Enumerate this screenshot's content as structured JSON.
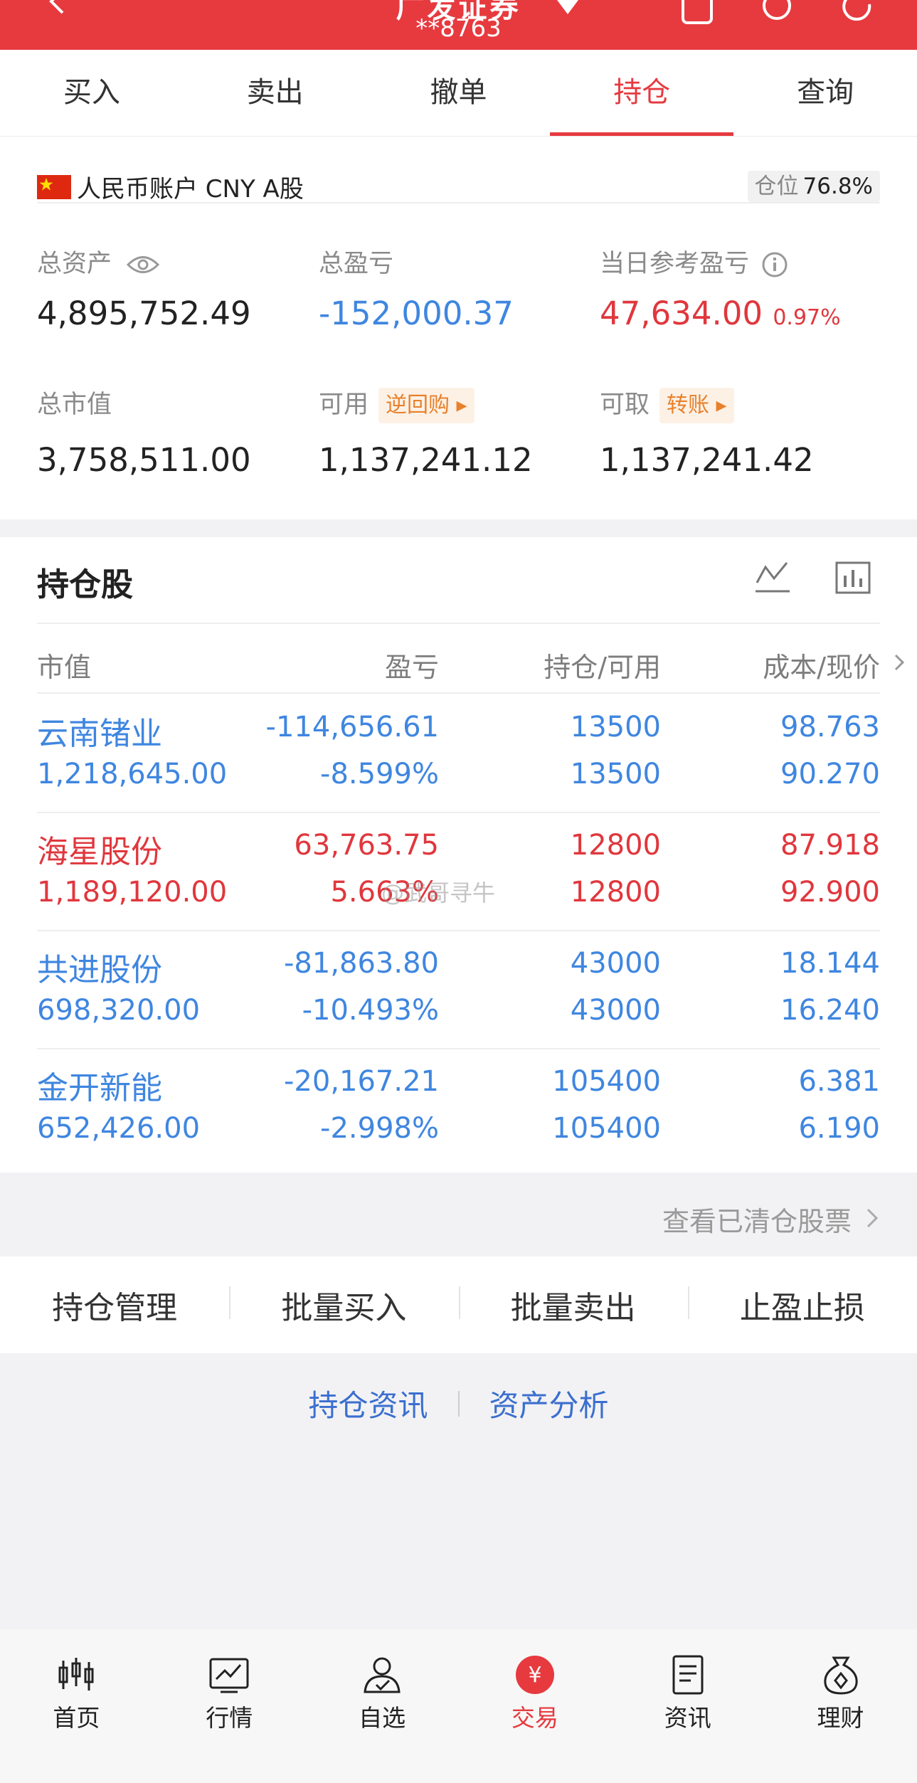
{
  "header": {
    "title": "广发证券",
    "account": "**8763"
  },
  "tabs": [
    {
      "label": "买入"
    },
    {
      "label": "卖出"
    },
    {
      "label": "撤单"
    },
    {
      "label": "持仓"
    },
    {
      "label": "查询"
    }
  ],
  "account": {
    "name": "人民币账户 CNY A股",
    "position_label": "仓位",
    "position_value": "76.8%"
  },
  "stats": {
    "total_assets_label": "总资产",
    "total_assets_value": "4,895,752.49",
    "total_pl_label": "总盈亏",
    "total_pl_value": "-152,000.37",
    "daily_pl_label": "当日参考盈亏",
    "daily_pl_value": "47,634.00",
    "daily_pl_pct": "0.97%",
    "market_value_label": "总市值",
    "market_value_value": "3,758,511.00",
    "available_label": "可用",
    "available_tag": "逆回购",
    "available_value": "1,137,241.12",
    "withdrawable_label": "可取",
    "withdrawable_tag": "转账",
    "withdrawable_value": "1,137,241.42"
  },
  "holdings": {
    "title": "持仓股",
    "columns": [
      "市值",
      "盈亏",
      "持仓/可用",
      "成本/现价"
    ],
    "rows": [
      {
        "name": "云南锗业",
        "market_value": "1,218,645.00",
        "pl": "-114,656.61",
        "pl_pct": "-8.599%",
        "hold": "13500",
        "avail": "13500",
        "cost": "98.763",
        "price": "90.270",
        "color": "#3f86e0"
      },
      {
        "name": "海星股份",
        "market_value": "1,189,120.00",
        "pl": "63,763.75",
        "pl_pct": "5.663%",
        "hold": "12800",
        "avail": "12800",
        "cost": "87.918",
        "price": "92.900",
        "color": "#e0373d"
      },
      {
        "name": "共进股份",
        "market_value": "698,320.00",
        "pl": "-81,863.80",
        "pl_pct": "-10.493%",
        "hold": "43000",
        "avail": "43000",
        "cost": "18.144",
        "price": "16.240",
        "color": "#3f86e0"
      },
      {
        "name": "金开新能",
        "market_value": "652,426.00",
        "pl": "-20,167.21",
        "pl_pct": "-2.998%",
        "hold": "105400",
        "avail": "105400",
        "cost": "6.381",
        "price": "6.190",
        "color": "#3f86e0"
      }
    ],
    "cleared_link": "查看已清仓股票"
  },
  "actions": [
    "持仓管理",
    "批量买入",
    "批量卖出",
    "止盈止损"
  ],
  "links": [
    "持仓资讯",
    "资产分析"
  ],
  "watermark": "@武哥寻牛",
  "bottom_nav": [
    {
      "label": "首页",
      "icon": "candlestick-icon"
    },
    {
      "label": "行情",
      "icon": "market-chart-icon"
    },
    {
      "label": "自选",
      "icon": "person-check-icon"
    },
    {
      "label": "交易",
      "icon": "yuan-circle-icon"
    },
    {
      "label": "资讯",
      "icon": "document-icon"
    },
    {
      "label": "理财",
      "icon": "money-bag-icon"
    }
  ],
  "colors": {
    "brand_red": "#e63a3f",
    "gain_red": "#e0373d",
    "loss_blue": "#3f86e0",
    "tag_orange": "#e8812c"
  }
}
